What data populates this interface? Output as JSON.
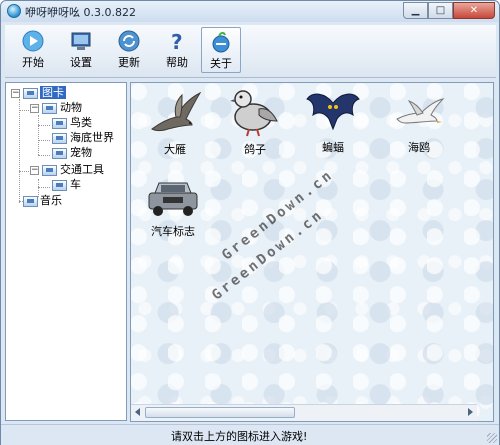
{
  "window": {
    "title": "咿呀咿呀吆 0.3.0.822"
  },
  "toolbar": {
    "buttons": [
      {
        "label": "开始",
        "icon": "play-icon"
      },
      {
        "label": "设置",
        "icon": "settings-screen-icon"
      },
      {
        "label": "更新",
        "icon": "update-icon"
      },
      {
        "label": "帮助",
        "icon": "help-icon"
      },
      {
        "label": "关于",
        "icon": "about-icon"
      }
    ]
  },
  "tree": {
    "root": "图卡",
    "animals": "动物",
    "birds": "鸟类",
    "ocean": "海底世界",
    "pets": "宠物",
    "transport": "交通工具",
    "car": "车",
    "music": "音乐"
  },
  "content": {
    "items": [
      "大雁",
      "鸽子",
      "蝙蝠",
      "海鸥",
      "汽车标志"
    ],
    "watermark": "GreenDown.cn"
  },
  "status": {
    "text": "请双击上方的图标进入游戏!"
  },
  "colors": {
    "selection": "#316ac5",
    "close_button": "#c8473a"
  }
}
